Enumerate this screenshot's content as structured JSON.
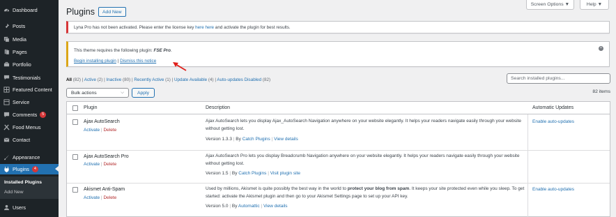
{
  "sidebar": {
    "items": [
      {
        "label": "Dashboard",
        "icon": "dashboard-icon"
      },
      {
        "label": "Posts",
        "icon": "pin-icon"
      },
      {
        "label": "Media",
        "icon": "media-icon"
      },
      {
        "label": "Pages",
        "icon": "pages-icon"
      },
      {
        "label": "Portfolio",
        "icon": "portfolio-icon"
      },
      {
        "label": "Testimonials",
        "icon": "testimonials-icon"
      },
      {
        "label": "Featured Content",
        "icon": "featured-icon"
      },
      {
        "label": "Service",
        "icon": "service-icon"
      },
      {
        "label": "Comments",
        "icon": "comments-icon",
        "badge": "5"
      },
      {
        "label": "Food Menus",
        "icon": "food-icon"
      },
      {
        "label": "Contact",
        "icon": "contact-icon"
      },
      {
        "label": "Appearance",
        "icon": "appearance-icon"
      },
      {
        "label": "Plugins",
        "icon": "plugins-icon",
        "badge": "4"
      },
      {
        "label": "Users",
        "icon": "users-icon"
      }
    ],
    "submenu": [
      "Installed Plugins",
      "Add New"
    ]
  },
  "header": {
    "title": "Plugins",
    "add_new": "Add New",
    "screen_options": "Screen Options ▼",
    "help": "Help ▼"
  },
  "notices": {
    "license_pre": "Lyna Pro has not been activated. Please enter the license key ",
    "license_link1": "here",
    "license_mid": " ",
    "license_link2": "here",
    "license_post": " and activate the plugin for best results.",
    "theme_pre": "This theme requires the following plugin: ",
    "theme_plugin": "FSE Pro",
    "theme_post": ".",
    "begin_install": "Begin installing plugin",
    "sep": " | ",
    "dismiss": "Dismiss this notice"
  },
  "filters": {
    "all": "All",
    "all_count": "(82)",
    "active": "Active",
    "active_count": "(2)",
    "inactive": "Inactive",
    "inactive_count": "(80)",
    "recent": "Recently Active",
    "recent_count": "(1)",
    "update": "Update Available",
    "update_count": "(4)",
    "autodisabled": "Auto-updates Disabled",
    "autodisabled_count": "(82)",
    "sep": " | "
  },
  "search": {
    "placeholder": "Search installed plugins..."
  },
  "bulk": {
    "label": "Bulk actions",
    "apply": "Apply",
    "items": "82 items"
  },
  "table": {
    "headers": {
      "plugin": "Plugin",
      "description": "Description",
      "auto": "Automatic Updates"
    },
    "rows": [
      {
        "name": "Ajax AutoSearch",
        "activate": "Activate",
        "delete": "Delete",
        "desc": "Ajax AutoSearch lets you display Ajax_AutoSearch Navigation anywhere on your website elegantly. It helps your readers navigate easily through your website without getting lost.",
        "version": "Version 1.3.3",
        "by": "By ",
        "author": "Catch Plugins",
        "details": "View details",
        "auto": "Enable auto-updates"
      },
      {
        "name": "Ajax AutoSearch Pro",
        "activate": "Activate",
        "delete": "Delete",
        "desc": "Ajax AutoSearch Pro lets you display Breadcrumb Navigation anywhere on your website elegantly. It helps your readers navigate easily through your website without getting lost.",
        "version": "Version 1.5",
        "by": "By ",
        "author": "Catch Plugins",
        "details": "Visit plugin site",
        "auto": ""
      },
      {
        "name": "Akismet Anti-Spam",
        "activate": "Activate",
        "delete": "Delete",
        "desc_pre": "Used by millions, Akismet is quite possibly the best way in the world to ",
        "desc_bold": "protect your blog from spam",
        "desc_post": ". It keeps your site protected even while you sleep. To get started: activate the Akismet plugin and then go to your Akismet Settings page to set up your API key.",
        "version": "Version 5.0",
        "by": "By ",
        "author": "Automattic",
        "details": "View details",
        "auto": "Enable auto-updates"
      }
    ]
  },
  "colors": {
    "accent": "#2271b1",
    "sidebar": "#1d2327",
    "error": "#d63638",
    "warning": "#dba617",
    "arrow": "#e0201b"
  }
}
